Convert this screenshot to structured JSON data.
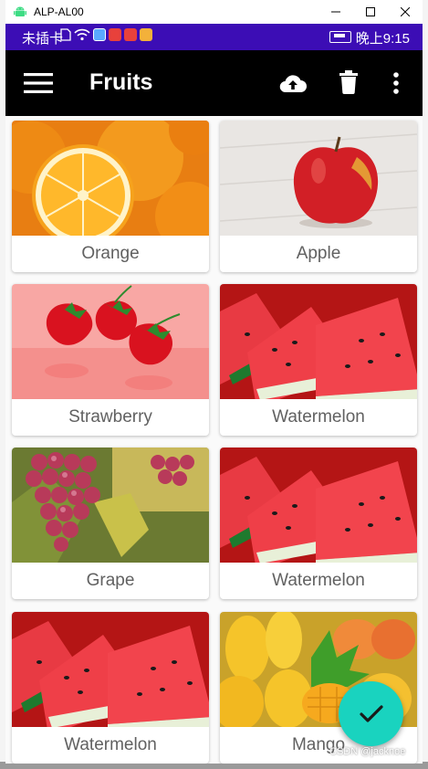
{
  "window": {
    "title": "ALP-AL00"
  },
  "status_bar": {
    "carrier": "未插卡",
    "time": "晚上9:15"
  },
  "toolbar": {
    "title": "Fruits",
    "icons": [
      "menu-icon",
      "cloud-upload-icon",
      "delete-icon",
      "more-vert-icon"
    ]
  },
  "fruits": [
    {
      "name": "Orange"
    },
    {
      "name": "Apple"
    },
    {
      "name": "Strawberry"
    },
    {
      "name": "Watermelon"
    },
    {
      "name": "Grape"
    },
    {
      "name": "Watermelon"
    },
    {
      "name": "Watermelon"
    },
    {
      "name": "Mango"
    }
  ],
  "fab": {
    "icon": "check-icon"
  },
  "watermark": "CSDN @jacknoe",
  "colors": {
    "status_bar": "#3c0db5",
    "app_bar": "#000000",
    "fab": "#19d3bf",
    "label_text": "#616161"
  }
}
